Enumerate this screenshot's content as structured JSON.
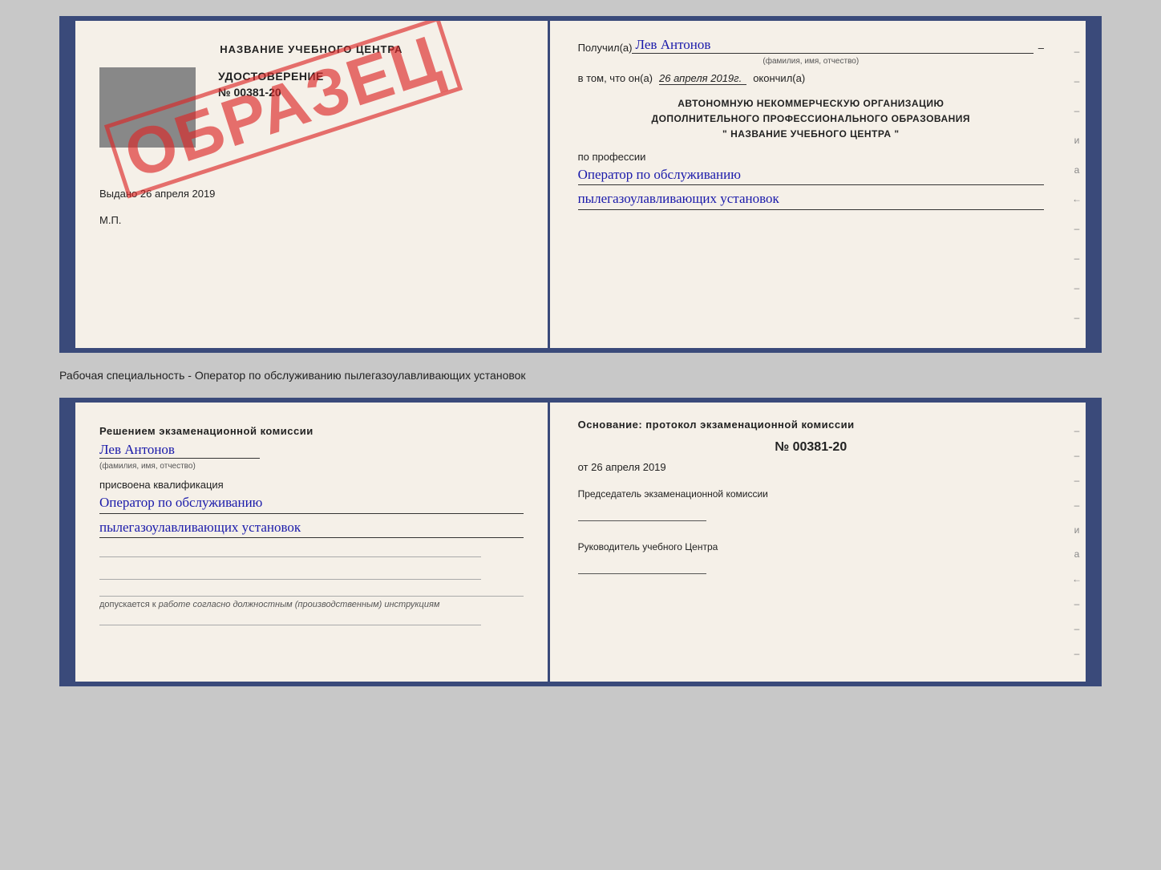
{
  "top_cert": {
    "left": {
      "center_name": "НАЗВАНИЕ УЧЕБНОГО ЦЕНТРА",
      "doc_title": "УДОСТОВЕРЕНИЕ",
      "doc_number": "№ 00381-20",
      "issued_label": "Выдано",
      "issued_date": "26 апреля 2019",
      "mp_label": "М.П.",
      "stamp_text": "ОБРАЗЕЦ"
    },
    "right": {
      "received_label": "Получил(а)",
      "recipient_name": "Лев Антонов",
      "fio_sublabel": "(фамилия, имя, отчество)",
      "date_line_prefix": "в том, что он(а)",
      "date_value": "26 апреля 2019г.",
      "completed_label": "окончил(а)",
      "org_line1": "АВТОНОМНУЮ НЕКОММЕРЧЕСКУЮ ОРГАНИЗАЦИЮ",
      "org_line2": "ДОПОЛНИТЕЛЬНОГО ПРОФЕССИОНАЛЬНОГО ОБРАЗОВАНИЯ",
      "org_line3": "\" НАЗВАНИЕ УЧЕБНОГО ЦЕНТРА \"",
      "profession_label": "по профессии",
      "profession_line1": "Оператор по обслуживанию",
      "profession_line2": "пылегазоулавливающих установок"
    }
  },
  "separator": {
    "text": "Рабочая специальность - Оператор по обслуживанию пылегазоулавливающих установок"
  },
  "bottom_cert": {
    "left": {
      "decision_title": "Решением экзаменационной комиссии",
      "person_name": "Лев Антонов",
      "fio_sublabel": "(фамилия, имя, отчество)",
      "qualification_label": "присвоена квалификация",
      "qualification_line1": "Оператор по обслуживанию",
      "qualification_line2": "пылегазоулавливающих установок",
      "blank_lines": [
        "",
        "",
        ""
      ],
      "allowed_prefix": "допускается к",
      "allowed_text": "работе согласно должностным (производственным) инструкциям"
    },
    "right": {
      "basis_label": "Основание: протокол экзаменационной комиссии",
      "protocol_number": "№ 00381-20",
      "protocol_date_prefix": "от",
      "protocol_date": "26 апреля 2019",
      "chairman_label": "Председатель экзаменационной комиссии",
      "director_label": "Руководитель учебного Центра"
    }
  },
  "side_dashes": [
    "-",
    "-",
    "-",
    "и",
    "а",
    "←",
    "-",
    "-",
    "-",
    "-"
  ],
  "side_dashes_bottom": [
    "-",
    "-",
    "-",
    "-",
    "и",
    "а",
    "←",
    "-",
    "-",
    "-"
  ]
}
